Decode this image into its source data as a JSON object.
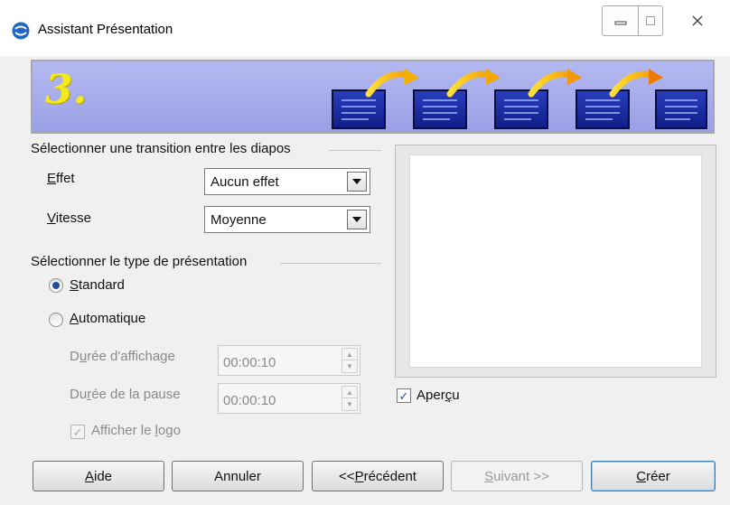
{
  "window": {
    "title": "Assistant Présentation"
  },
  "banner": {
    "step_number": "3."
  },
  "transition_group": {
    "title": "Sélectionner une transition entre les diapos",
    "effect_label_key": "E",
    "effect_label_rest": "ffet",
    "effect_value": "Aucun effet",
    "speed_label_key": "V",
    "speed_label_rest": "itesse",
    "speed_value": "Moyenne"
  },
  "type_group": {
    "title": "Sélectionner le type de présentation",
    "standard_key": "S",
    "standard_rest": "tandard",
    "standard_checked": true,
    "automatic_key": "A",
    "automatic_rest": "utomatique",
    "automatic_checked": false,
    "display_duration_pre": "D",
    "display_duration_key": "u",
    "display_duration_post": "rée d'affichage",
    "display_duration_value": "00:00:10",
    "pause_duration_pre": "Du",
    "pause_duration_key": "r",
    "pause_duration_post": "ée de la pause",
    "pause_duration_value": "00:00:10",
    "show_logo_pre": "Afficher le ",
    "show_logo_key": "l",
    "show_logo_post": "ogo",
    "show_logo_checked": true
  },
  "preview": {
    "label_pre": "Aper",
    "label_key": "ç",
    "label_post": "u",
    "checked": true
  },
  "buttons": {
    "help_key": "A",
    "help_rest": "ide",
    "cancel": "Annuler",
    "previous_pre": "<< ",
    "previous_key": "P",
    "previous_post": "récédent",
    "next_key": "S",
    "next_rest": "uivant >>",
    "create_key": "C",
    "create_rest": "réer"
  },
  "colors": {
    "banner": "#9aa0e6",
    "step_number": "#f2ea1c",
    "slide_icon": "#1a2a9c",
    "arrow": "#f5b800",
    "accent": "#1f4f9e"
  }
}
